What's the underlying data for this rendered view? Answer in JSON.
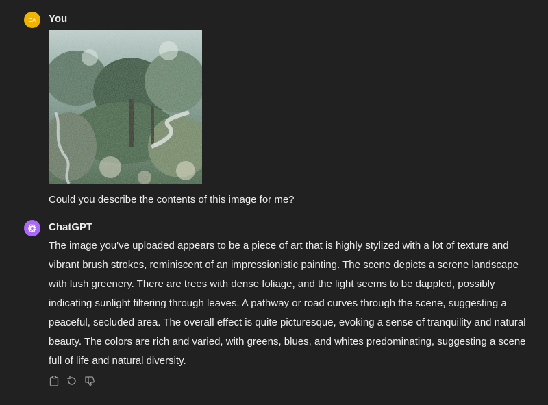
{
  "user_message": {
    "avatar_initials": "CA",
    "author": "You",
    "text": "Could you describe the contents of this image for me?"
  },
  "assistant_message": {
    "author": "ChatGPT",
    "text": "The image you've uploaded appears to be a piece of art that is highly stylized with a lot of texture and vibrant brush strokes, reminiscent of an impressionistic painting. The scene depicts a serene landscape with lush greenery. There are trees with dense foliage, and the light seems to be dappled, possibly indicating sunlight filtering through leaves. A pathway or road curves through the scene, suggesting a peaceful, secluded area. The overall effect is quite picturesque, evoking a sense of tranquility and natural beauty. The colors are rich and varied, with greens, blues, and whites predominating, suggesting a scene full of life and natural diversity."
  },
  "actions": [
    "copy-icon",
    "regenerate-icon",
    "thumbs-down-icon"
  ],
  "colors": {
    "background": "#212121",
    "text": "#ececec",
    "user_avatar": "#f0b400",
    "assistant_avatar": "#ab68ff",
    "icon": "#9b9b9b"
  }
}
